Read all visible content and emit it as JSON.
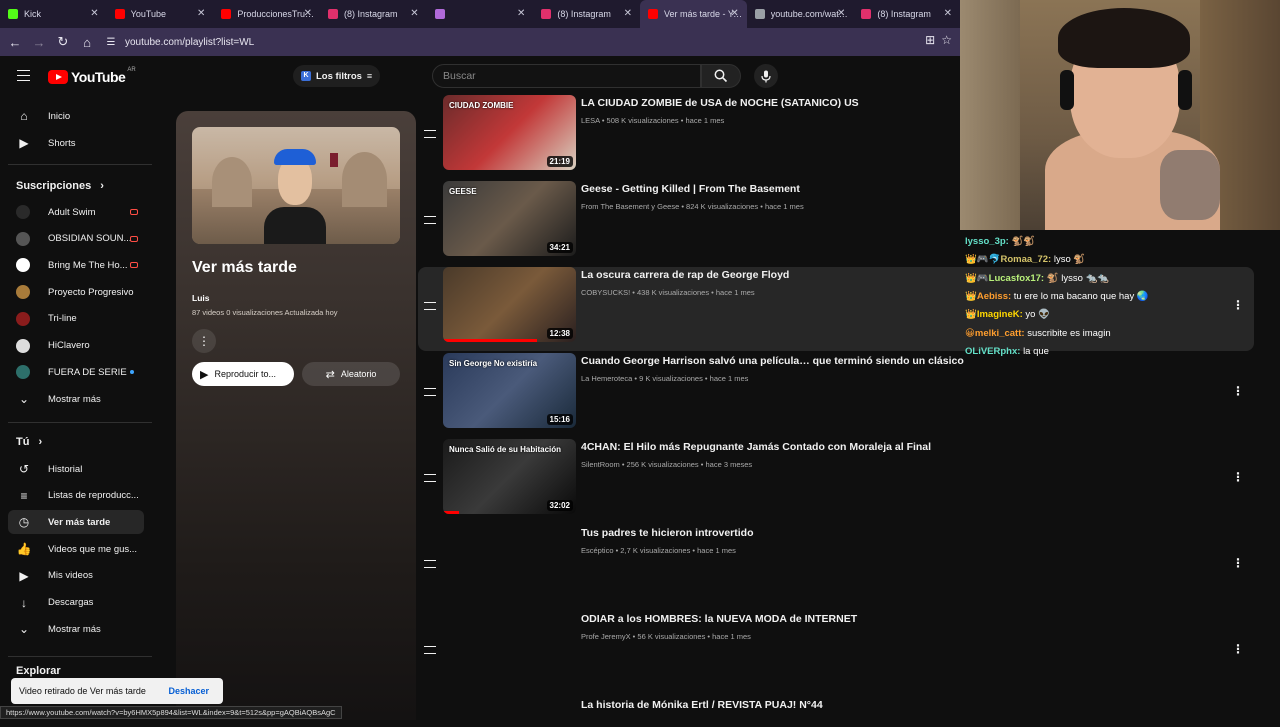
{
  "browser": {
    "tabs": [
      {
        "label": "Kick",
        "color": "#53fc18"
      },
      {
        "label": "YouTube",
        "color": "#ff0000"
      },
      {
        "label": "ProduccionesTrukini",
        "color": "#ff0000"
      },
      {
        "label": "(8) Instagram",
        "color": "#e1306c"
      },
      {
        "label": "",
        "color": "#b06ad9"
      },
      {
        "label": "(8) Instagram",
        "color": "#e1306c"
      },
      {
        "label": "Ver más tarde - YouT",
        "color": "#ff0000"
      },
      {
        "label": "youtube.com/watch?",
        "color": "#9aa0a6"
      },
      {
        "label": "(8) Instagram",
        "color": "#e1306c"
      }
    ],
    "url": "youtube.com/playlist?list=WL"
  },
  "header": {
    "logo_text": "YouTube",
    "country": "AR",
    "filters_label": "Los filtros",
    "search_placeholder": "Buscar"
  },
  "sidebar": {
    "main": [
      {
        "label": "Inicio",
        "icon": "home-icon"
      },
      {
        "label": "Shorts",
        "icon": "shorts-icon"
      }
    ],
    "subs_heading": "Suscripciones",
    "subs": [
      {
        "label": "Adult Swim",
        "avatar": "#2a2a2a",
        "badge": "live"
      },
      {
        "label": "OBSIDIAN SOUN...",
        "avatar": "#555555",
        "badge": "live"
      },
      {
        "label": "Bring Me The Ho...",
        "avatar": "#ffffff",
        "badge": "live"
      },
      {
        "label": "Proyecto Progresivo",
        "avatar": "#a87b3a",
        "badge": ""
      },
      {
        "label": "Tri-line",
        "avatar": "#8a1c1c",
        "badge": ""
      },
      {
        "label": "HiClavero",
        "avatar": "#dddddd",
        "badge": ""
      },
      {
        "label": "FUERA DE SERIE",
        "avatar": "#2d6f6a",
        "badge": "dot"
      }
    ],
    "subs_more": "Mostrar más",
    "you_heading": "Tú",
    "you": [
      {
        "label": "Historial",
        "icon": "history-icon"
      },
      {
        "label": "Listas de reproducc...",
        "icon": "playlists-icon"
      },
      {
        "label": "Ver más tarde",
        "icon": "watch-later-icon",
        "active": true
      },
      {
        "label": "Videos que me gus...",
        "icon": "like-icon"
      },
      {
        "label": "Mis videos",
        "icon": "my-videos-icon"
      },
      {
        "label": "Descargas",
        "icon": "download-icon"
      },
      {
        "label": "Mostrar más",
        "icon": "chevron-down-icon"
      }
    ],
    "explore_heading": "Explorar"
  },
  "playlist": {
    "title": "Ver más tarde",
    "owner": "Luis",
    "meta": "87 videos   0 visualizaciones   Actualizada hoy",
    "play_all": "Reproducir to...",
    "shuffle": "Aleatorio"
  },
  "videos": [
    {
      "title": "LA CIUDAD ZOMBIE de USA de NOCHE (SATANICO) US",
      "meta": "LESA • 508 K visualizaciones • hace 1 mes",
      "duration": "21:19",
      "thumb": [
        "#6b2b2b",
        "#c23838",
        "#d8d0c0"
      ],
      "thumb_text": "CIUDAD ZOMBIE",
      "progress": 0
    },
    {
      "title": "Geese - Getting Killed | From The Basement",
      "meta": "From The Basement y Geese • 824 K visualizaciones • hace 1 mes",
      "duration": "34:21",
      "thumb": [
        "#3a3a3a",
        "#6a5a4a",
        "#1c1c1c"
      ],
      "thumb_text": "GEESE",
      "progress": 0
    },
    {
      "title": "La oscura carrera de rap de George Floyd",
      "meta": "COBYSUCKS! • 438 K visualizaciones • hace 1 mes",
      "duration": "12:38",
      "thumb": [
        "#4a3a2a",
        "#7a5a3a",
        "#2a2020"
      ],
      "thumb_text": "",
      "progress": 0.71
    },
    {
      "title": "Cuando George Harrison salvó una película… que terminó siendo un clásico",
      "meta": "La Hemeroteca • 9 K visualizaciones • hace 1 mes",
      "duration": "15:16",
      "thumb": [
        "#2a3a5a",
        "#4a5a7a",
        "#1a2a3a"
      ],
      "thumb_text": "Sin George No existiría",
      "progress": 0
    },
    {
      "title": "4CHAN: El Hilo más Repugnante Jamás Contado con Moraleja al Final",
      "meta": "SilentRoom • 256 K visualizaciones • hace 3 meses",
      "duration": "32:02",
      "thumb": [
        "#1a1a1a",
        "#3a3a3a",
        "#0a0a0a"
      ],
      "thumb_text": "Nunca Salió de su Habitación",
      "progress": 0.12
    },
    {
      "title": "Tus padres te hicieron introvertido",
      "meta": "Escéptico • 2,7 K visualizaciones • hace 1 mes",
      "duration": "",
      "thumb": [
        "#0f0f0f",
        "#0f0f0f",
        "#0f0f0f"
      ],
      "thumb_text": "",
      "progress": 0
    },
    {
      "title": "ODIAR a los HOMBRES: la NUEVA MODA de INTERNET",
      "meta": "Profe JeremyX • 56 K visualizaciones • hace 1 mes",
      "duration": "",
      "thumb": [
        "#0f0f0f",
        "#0f0f0f",
        "#0f0f0f"
      ],
      "thumb_text": "",
      "progress": 0
    },
    {
      "title": "La historia de Mónika Ertl / REVISTA PUAJ! N°44",
      "meta": "",
      "duration": "",
      "thumb": [
        "#0f0f0f",
        "#0f0f0f",
        "#0f0f0f"
      ],
      "thumb_text": "",
      "progress": 0
    }
  ],
  "chat": [
    {
      "user": "lysso_3p:",
      "text": "🐒🐒",
      "color": "#64e0c8"
    },
    {
      "user": "👑🎮🐬Romaa_72:",
      "text": "lyso 🐒",
      "color": "#d4c36a"
    },
    {
      "user": "👑🎮Lucasfox17:",
      "text": "🐒 lysso 🐀🐀",
      "color": "#b8f07a"
    },
    {
      "user": "👑Aebiss:",
      "text": "tu ere lo ma bacano que hay 🌏",
      "color": "#ff9e2e"
    },
    {
      "user": "👑ImagineK:",
      "text": "yo 👽",
      "color": "#ffd700"
    },
    {
      "user": "😀melki_catt:",
      "text": "suscribite es imagin",
      "color": "#ff9e2e"
    },
    {
      "user": "OLiVERphx:",
      "text": "la que",
      "color": "#64e0c8"
    }
  ],
  "toast": {
    "text": "Video retirado de Ver más tarde",
    "action": "Deshacer"
  },
  "status_url": "https://www.youtube.com/watch?v=by6HMX5p894&list=WL&index=9&t=512s&pp=gAQBiAQBsAgC"
}
